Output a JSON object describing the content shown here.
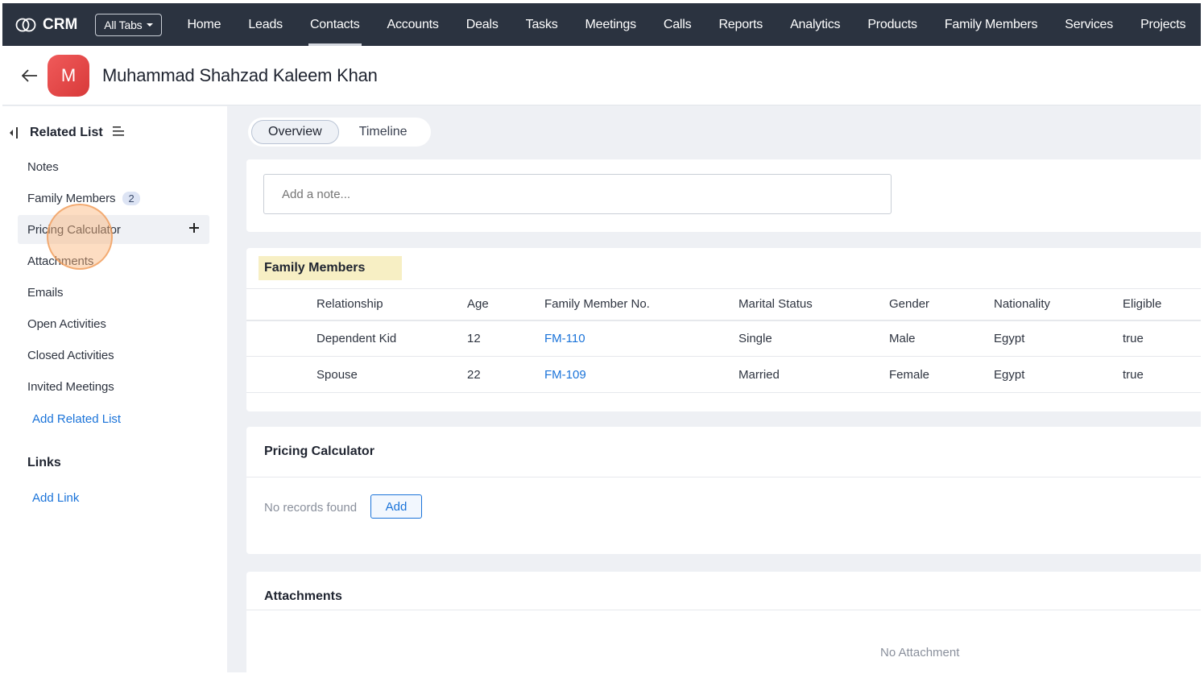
{
  "app": {
    "name": "CRM",
    "all_tabs": "All Tabs"
  },
  "nav": {
    "tabs": [
      {
        "label": "Home"
      },
      {
        "label": "Leads"
      },
      {
        "label": "Contacts",
        "active": true
      },
      {
        "label": "Accounts"
      },
      {
        "label": "Deals"
      },
      {
        "label": "Tasks"
      },
      {
        "label": "Meetings"
      },
      {
        "label": "Calls"
      },
      {
        "label": "Reports"
      },
      {
        "label": "Analytics"
      },
      {
        "label": "Products"
      },
      {
        "label": "Family Members"
      },
      {
        "label": "Services"
      },
      {
        "label": "Projects"
      }
    ]
  },
  "record": {
    "avatar_letter": "M",
    "avatar_color": "#e2474b",
    "name": "Muhammad Shahzad Kaleem Khan"
  },
  "sidebar": {
    "related_list_title": "Related List",
    "items": [
      {
        "label": "Notes"
      },
      {
        "label": "Family Members",
        "count": "2"
      },
      {
        "label": "Pricing Calculator",
        "highlighted": true
      },
      {
        "label": "Attachments"
      },
      {
        "label": "Emails"
      },
      {
        "label": "Open Activities"
      },
      {
        "label": "Closed Activities"
      },
      {
        "label": "Invited Meetings"
      }
    ],
    "add_related_list": "Add Related List",
    "links_title": "Links",
    "add_link": "Add Link"
  },
  "tabs": {
    "overview": "Overview",
    "timeline": "Timeline",
    "active": "Overview"
  },
  "notes": {
    "placeholder": "Add a note..."
  },
  "family_members": {
    "title": "Family Members",
    "columns": [
      "Relationship",
      "Age",
      "Family Member No.",
      "Marital Status",
      "Gender",
      "Nationality",
      "Eligible"
    ],
    "rows": [
      [
        "Dependent Kid",
        "12",
        "FM-110",
        "Single",
        "Male",
        "Egypt",
        "true"
      ],
      [
        "Spouse",
        "22",
        "FM-109",
        "Married",
        "Female",
        "Egypt",
        "true"
      ]
    ]
  },
  "pricing_calculator": {
    "title": "Pricing Calculator",
    "empty_text": "No records found",
    "add_label": "Add"
  },
  "attachments": {
    "title": "Attachments",
    "empty_text": "No Attachment"
  },
  "colors": {
    "nav_bg": "#2b3340",
    "link": "#1a73d9",
    "highlight_title_bg": "#f7efc4"
  }
}
